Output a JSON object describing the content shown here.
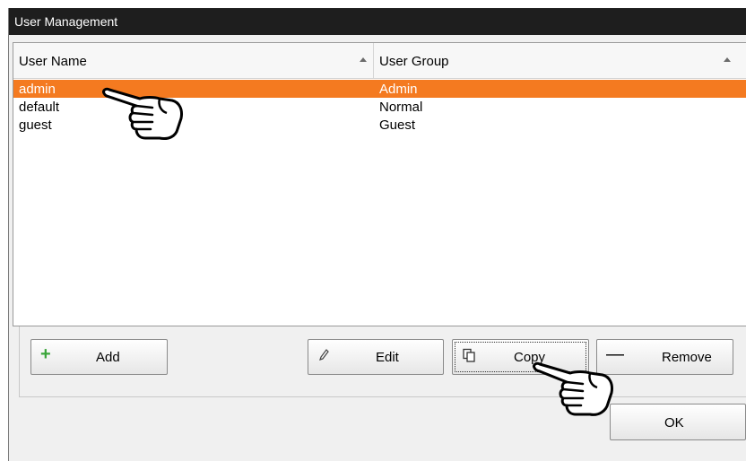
{
  "window": {
    "title": "User Management"
  },
  "table": {
    "columns": [
      "User Name",
      "User Group"
    ],
    "rows": [
      {
        "name": "admin",
        "group": "Admin",
        "selected": true
      },
      {
        "name": "default",
        "group": "Normal",
        "selected": false
      },
      {
        "name": "guest",
        "group": "Guest",
        "selected": false
      }
    ]
  },
  "buttons": {
    "add": "Add",
    "edit": "Edit",
    "copy": "Copy",
    "remove": "Remove",
    "ok": "OK"
  },
  "colors": {
    "selection": "#f47a20",
    "titlebar": "#1e1e1e",
    "add_icon": "#3aa53a"
  },
  "icons": [
    "plus-icon",
    "pencil-icon",
    "copy-icon",
    "minus-icon",
    "pointing-hand-icon"
  ]
}
